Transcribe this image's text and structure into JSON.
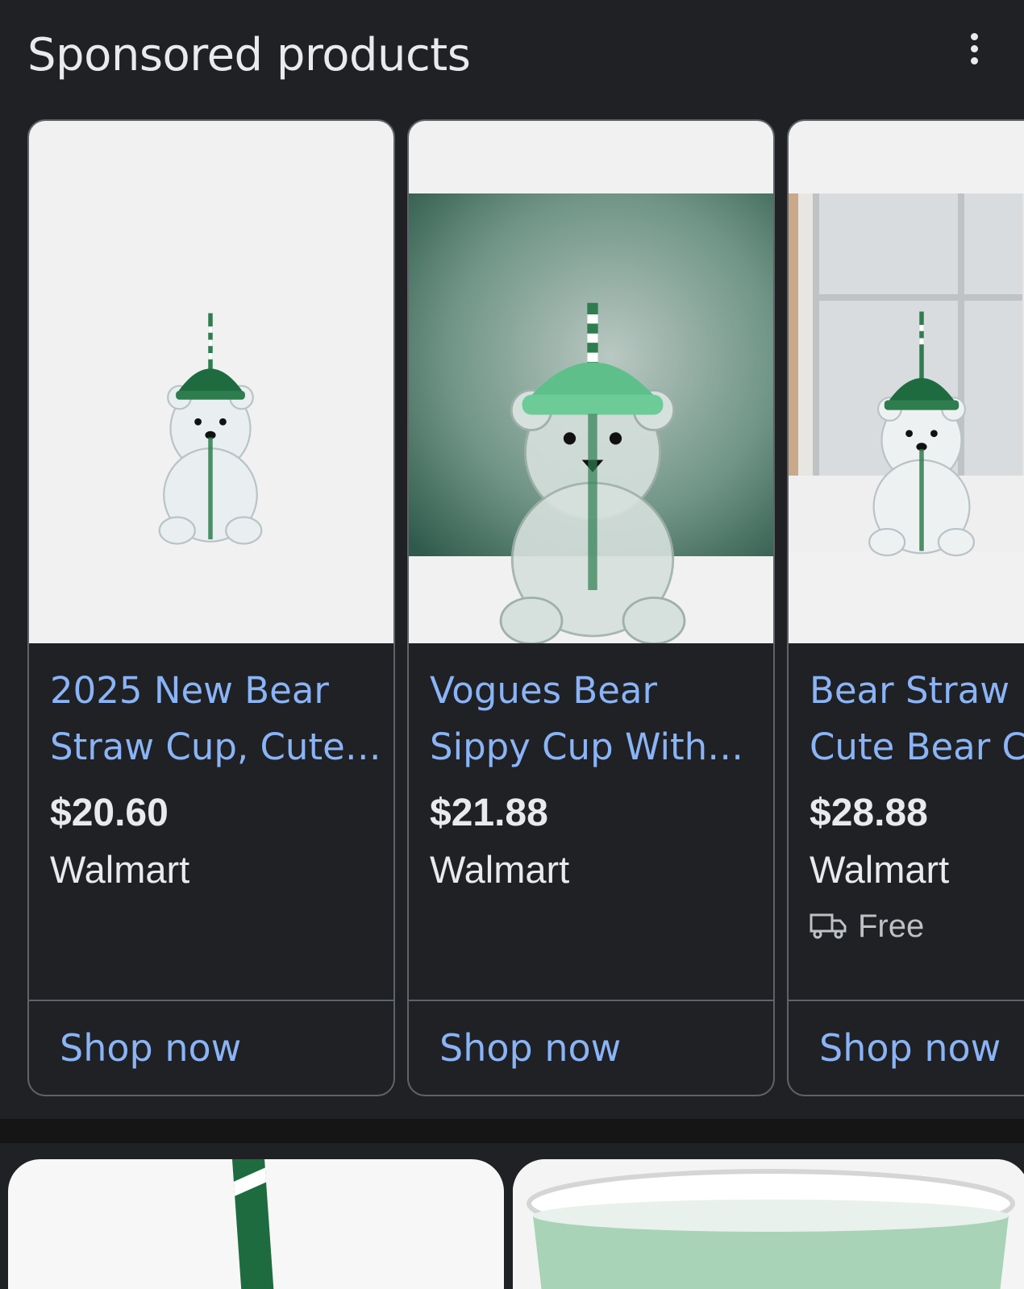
{
  "header": {
    "title": "Sponsored products",
    "more_icon": "more-vert-icon"
  },
  "products": [
    {
      "name_line1": "2025 New Bear",
      "name_line2": "Straw Cup, Cute…",
      "price": "$20.60",
      "store": "Walmart",
      "cta": "Shop now",
      "image_background": "white"
    },
    {
      "name_line1": "Vogues Bear",
      "name_line2": "Sippy Cup With…",
      "price": "$21.88",
      "store": "Walmart",
      "cta": "Shop now",
      "image_background": "green-studio"
    },
    {
      "name_line1": "Bear Straw",
      "name_line2": "Cute Bear C",
      "price": "$28.88",
      "store": "Walmart",
      "shipping": "Free",
      "shipping_icon": "delivery-truck-icon",
      "cta": "Shop now",
      "image_background": "window-scene"
    }
  ],
  "colors": {
    "background": "#202124",
    "link": "#8ab4f8",
    "text": "#e8eaed",
    "border": "#5f6368",
    "lid_green": "#2e7d4f"
  }
}
